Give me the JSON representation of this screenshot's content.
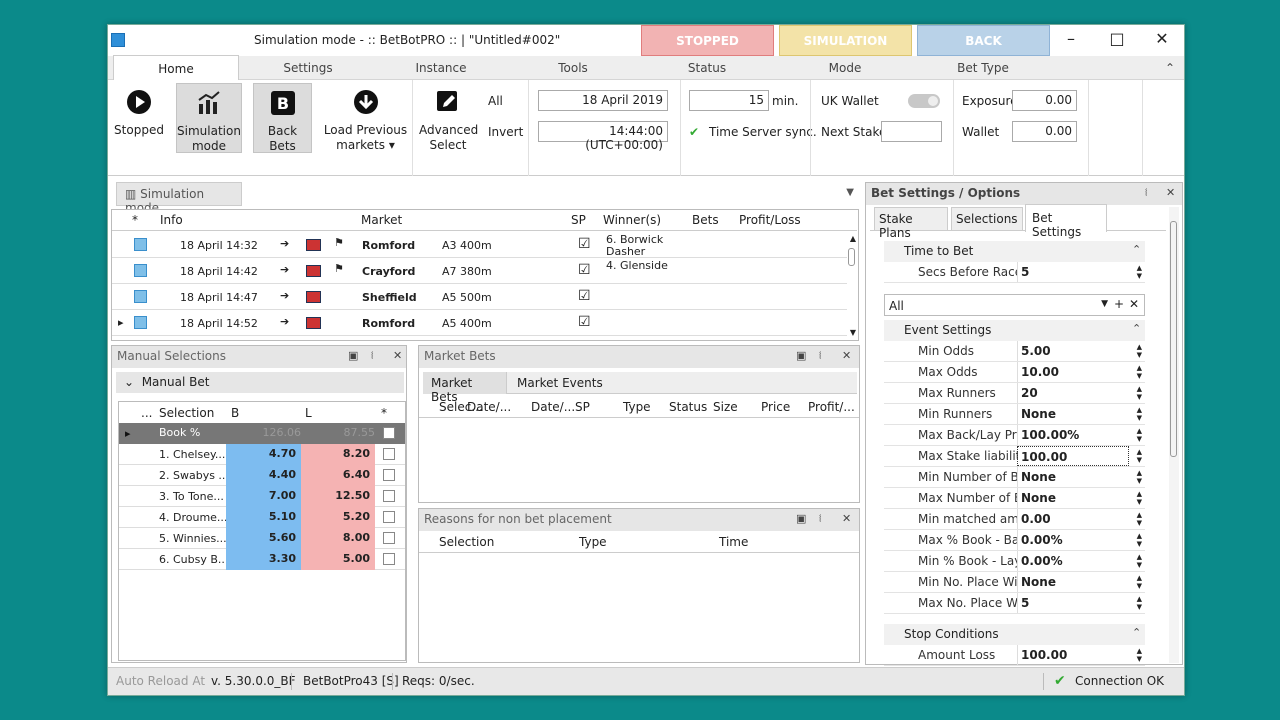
{
  "window": {
    "title": "Simulation mode - :: BetBotPRO :: | \"Untitled#002\"",
    "states": [
      "STOPPED",
      "SIMULATION",
      "BACK"
    ]
  },
  "menu": [
    "Home",
    "Settings",
    "Instance",
    "Tools",
    "Status",
    "Mode",
    "Bet Type"
  ],
  "ribbon": {
    "stopped": "Stopped",
    "simulation": [
      "Simulation",
      "mode"
    ],
    "back_bets": "Back Bets",
    "load_previous": [
      "Load Previous",
      "markets"
    ],
    "advanced_select": [
      "Advanced",
      "Select"
    ],
    "all": "All",
    "invert": "Invert",
    "date": "18 April 2019",
    "time": "14:44:00 (UTC+00:00)",
    "minutes": "15",
    "min_label": "min.",
    "time_server": "Time Server sync.",
    "uk_wallet": "UK Wallet",
    "next_stake": "Next Stake",
    "exposure_label": "Exposure",
    "exposure": "0.00",
    "wallet_label": "Wallet",
    "wallet": "0.00"
  },
  "main_tab": "Simulation mode",
  "markets": {
    "headers": [
      "*",
      "Info",
      "Market",
      "SP",
      "Winner(s)",
      "Bets",
      "Profit/Loss"
    ],
    "rows": [
      {
        "info": "18 April 14:32",
        "market": "Romford",
        "race": "A3 400m",
        "winners": "6. Borwick Dasher",
        "flag2": true
      },
      {
        "info": "18 April 14:42",
        "market": "Crayford",
        "race": "A7 380m",
        "winners": "4. Glenside",
        "flag2": true
      },
      {
        "info": "18 April 14:47",
        "market": "Sheffield",
        "race": "A5 500m",
        "winners": "",
        "flag2": false
      },
      {
        "info": "18 April 14:52",
        "market": "Romford",
        "race": "A5 400m",
        "winners": "",
        "flag2": false
      }
    ]
  },
  "manual": {
    "title": "Manual Selections",
    "sub": "Manual Bet",
    "headers": [
      "...",
      "Selection",
      "B",
      "L",
      "*"
    ],
    "book": {
      "name": "Book %",
      "b": "126.06",
      "l": "87.55"
    },
    "rows": [
      {
        "name": "1. Chelsey...",
        "b": "4.70",
        "l": "8.20"
      },
      {
        "name": "2. Swabys ...",
        "b": "4.40",
        "l": "6.40"
      },
      {
        "name": "3. To Tone...",
        "b": "7.00",
        "l": "12.50"
      },
      {
        "name": "4. Droume...",
        "b": "5.10",
        "l": "5.20"
      },
      {
        "name": "5. Winnies...",
        "b": "5.60",
        "l": "8.00"
      },
      {
        "name": "6. Cubsy B...",
        "b": "3.30",
        "l": "5.00"
      }
    ]
  },
  "market_bets": {
    "title": "Market Bets",
    "tabs": [
      "Market Bets",
      "Market Events"
    ],
    "headers": [
      "Selec...",
      "Date/...",
      "Date/...",
      "SP",
      "Type",
      "Status",
      "Size",
      "Price",
      "Profit/..."
    ]
  },
  "reasons": {
    "title": "Reasons for non bet placement",
    "headers": [
      "Selection",
      "Type",
      "Time"
    ]
  },
  "settings": {
    "title": "Bet Settings / Options",
    "tabs": [
      "Stake Plans",
      "Selections",
      "Bet Settings"
    ],
    "time_group": "Time to Bet",
    "secs": {
      "name": "Secs Before Race S",
      "val": "5"
    },
    "filter": "All",
    "event_group": "Event Settings",
    "rows": [
      {
        "name": "Min Odds",
        "val": "5.00"
      },
      {
        "name": "Max Odds",
        "val": "10.00"
      },
      {
        "name": "Max Runners",
        "val": "20"
      },
      {
        "name": "Min Runners",
        "val": "None"
      },
      {
        "name": "Max Back/Lay Pric",
        "val": "100.00%"
      },
      {
        "name": "Max Stake liability",
        "val": "100.00"
      },
      {
        "name": "Min Number of Be",
        "val": "None"
      },
      {
        "name": "Max Number of Be",
        "val": "None"
      },
      {
        "name": "Min matched amo",
        "val": "0.00"
      },
      {
        "name": "Max % Book - Bac",
        "val": "0.00%"
      },
      {
        "name": "Min % Book - Lay",
        "val": "0.00%"
      },
      {
        "name": "Min No. Place Win",
        "val": "None"
      },
      {
        "name": "Max No. Place Win",
        "val": "5"
      }
    ],
    "stop_group": "Stop Conditions",
    "amount_loss": {
      "name": "Amount Loss",
      "val": "100.00"
    }
  },
  "status": {
    "auto_reload": "Auto Reload At",
    "version": "v. 5.30.0.0_BF",
    "bot": "BetBotPro43 [S]",
    "reqs": "Reqs: 0/sec.",
    "connection": "Connection OK"
  }
}
